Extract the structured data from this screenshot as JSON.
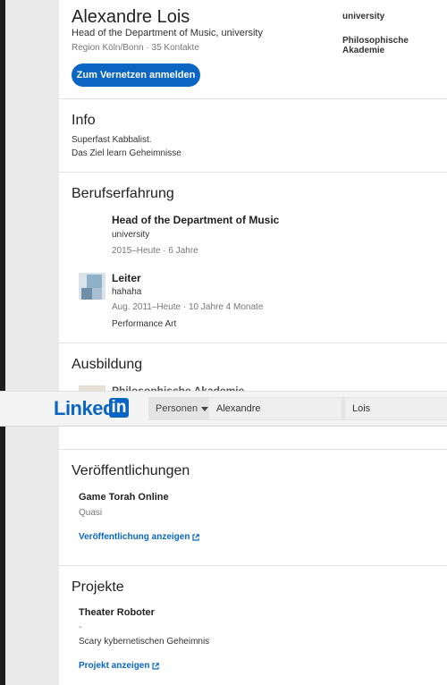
{
  "profile": {
    "name": "Alexandre Lois",
    "headline": "Head of the Department of Music, university",
    "location": "Region Köln/Bonn",
    "connections": "35 Kontakte",
    "connect_button": "Zum Vernetzen anmelden",
    "side": [
      "university",
      "Philosophische Akademie"
    ]
  },
  "info": {
    "title": "Info",
    "lines": [
      "Superfast Kabbalist.",
      "Das Ziel learn Geheimnisse"
    ]
  },
  "experience": {
    "title": "Berufserfahrung",
    "items": [
      {
        "title": "Head of the Department of Music",
        "org": "university",
        "dates": "2015–Heute · 6 Jahre"
      },
      {
        "title": "Leiter",
        "org": "hahaha",
        "dates": "Aug. 2011–Heute · 10 Jahre 4 Monate",
        "note": "Performance Art"
      }
    ]
  },
  "education": {
    "title": "Ausbildung",
    "partial_item": "Philosophische Akademie"
  },
  "navbar": {
    "logo_text": "Linked",
    "logo_box": "in",
    "search_type": "Personen",
    "first_name": "Alexandre",
    "last_name": "Lois"
  },
  "publications": {
    "title": "Veröffentlichungen",
    "item_title": "Game Torah Online",
    "item_sub": "Quasi",
    "link": "Veröffentlichung anzeigen"
  },
  "projects": {
    "title": "Projekte",
    "item_title": "Theater Roboter",
    "item_sub": "-",
    "item_desc": "Scary kybernetischen Geheimnis",
    "link": "Projekt anzeigen"
  },
  "colors": {
    "accent": "#0a66c2"
  }
}
